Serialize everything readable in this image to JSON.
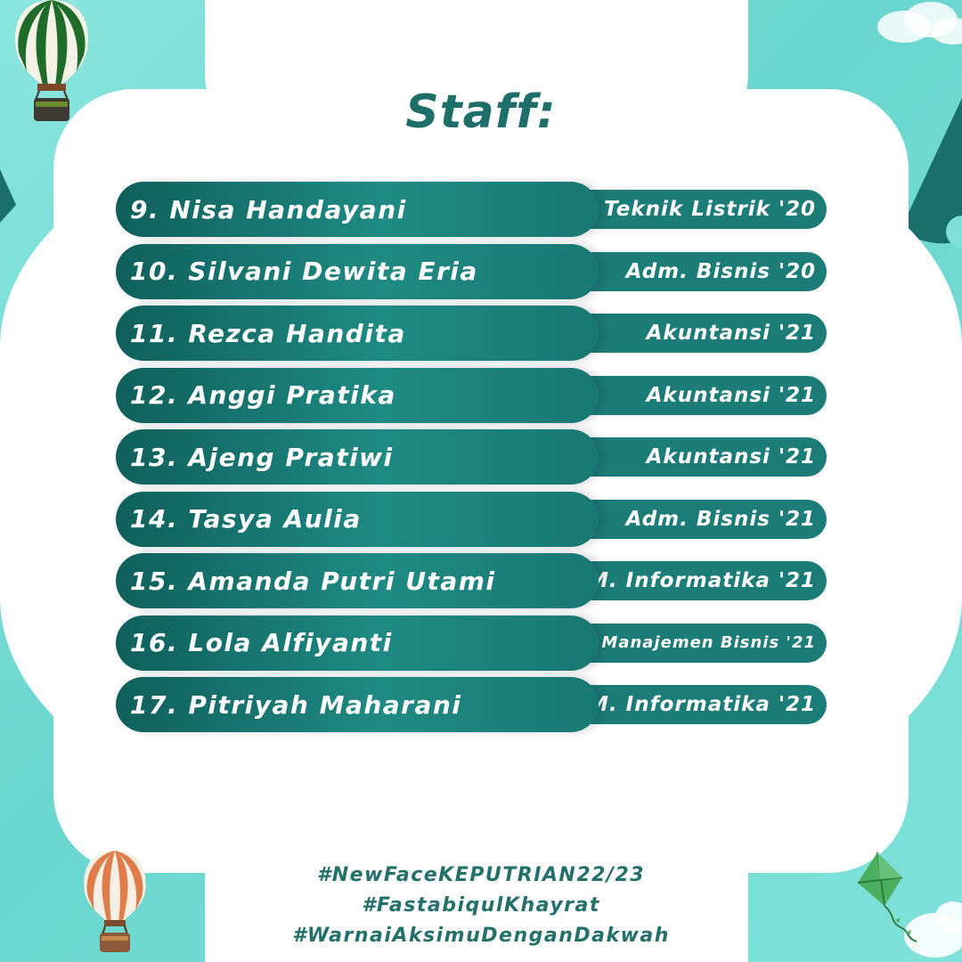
{
  "title": "Staff:",
  "staff": [
    {
      "name": "9. Nisa Handayani",
      "dept": "Teknik Listrik '20"
    },
    {
      "name": "10. Silvani Dewita Eria",
      "dept": "Adm. Bisnis '20"
    },
    {
      "name": "11. Rezca Handita",
      "dept": "Akuntansi '21"
    },
    {
      "name": "12. Anggi Pratika",
      "dept": "Akuntansi '21"
    },
    {
      "name": "13. Ajeng Pratiwi",
      "dept": "Akuntansi '21"
    },
    {
      "name": "14. Tasya Aulia",
      "dept": "Adm. Bisnis '21"
    },
    {
      "name": "15. Amanda Putri Utami",
      "dept": "M. Informatika '21"
    },
    {
      "name": "16. Lola Alfiyanti",
      "dept": "Manajemen Bisnis '21"
    },
    {
      "name": "17. Pitriyah Maharani",
      "dept": "M. Informatika '21"
    }
  ],
  "hashtags": [
    "#NewFaceKEPUTRIAN22/23",
    "#FastabiqulKhayrat",
    "#WarnaiAksimuDenganDakwah"
  ],
  "colors": {
    "background": "#7fe0d9",
    "accent": "#1c7c77",
    "text_dark": "#1e6f6a"
  },
  "icons": [
    "hot-air-balloon-green-icon",
    "hot-air-balloon-orange-icon",
    "kite-icon",
    "cloud-icon"
  ]
}
